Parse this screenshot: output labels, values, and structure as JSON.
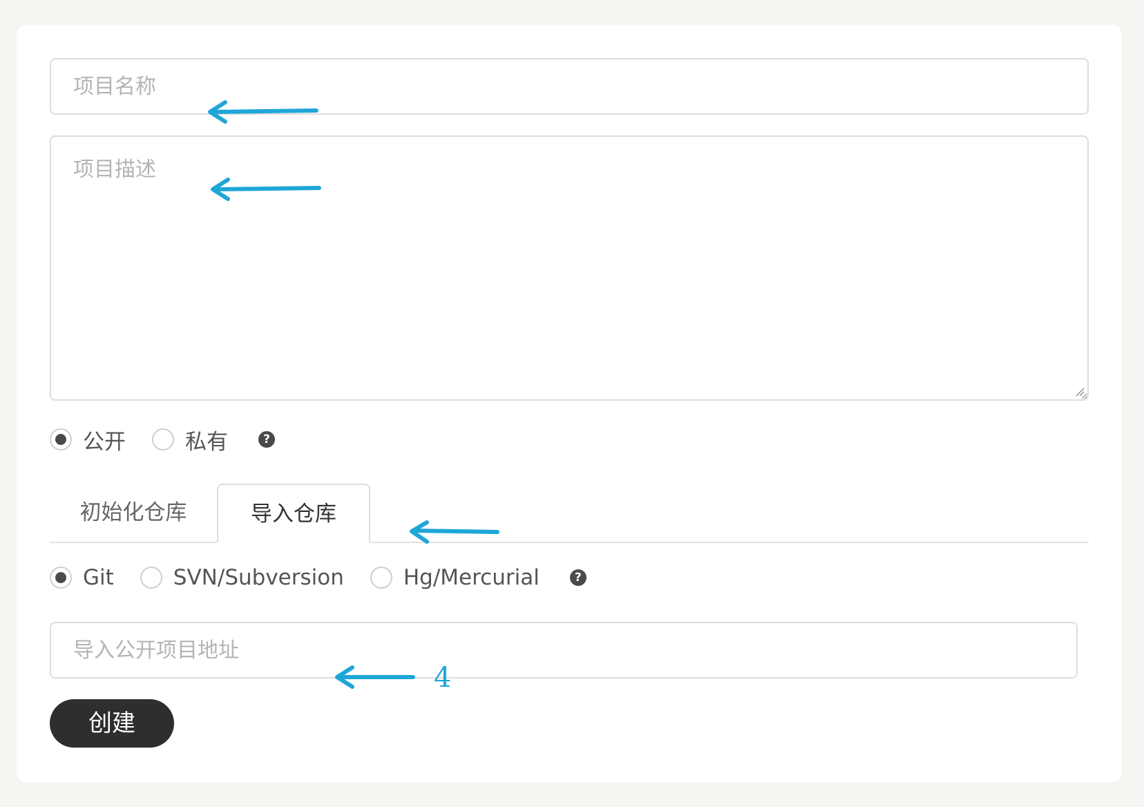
{
  "form": {
    "name_placeholder": "项目名称",
    "description_placeholder": "项目描述",
    "visibility": {
      "options": [
        {
          "label": "公开",
          "selected": true
        },
        {
          "label": "私有",
          "selected": false
        }
      ],
      "help_icon": "question-circle-icon"
    },
    "tabs": [
      {
        "label": "初始化仓库",
        "active": false
      },
      {
        "label": "导入仓库",
        "active": true
      }
    ],
    "vcs": {
      "options": [
        {
          "label": "Git",
          "selected": true
        },
        {
          "label": "SVN/Subversion",
          "selected": false
        },
        {
          "label": "Hg/Mercurial",
          "selected": false
        }
      ],
      "help_icon": "question-circle-icon"
    },
    "import_url_placeholder": "导入公开项目地址",
    "submit_label": "创建"
  },
  "annotations": {
    "arrow_color": "#1ea6d8",
    "number_label": "4"
  },
  "colors": {
    "page_background": "#f6f5f2",
    "card_background": "#ffffff",
    "button_background": "#2e2e2e",
    "radio_selected": "#4a4a4a"
  }
}
